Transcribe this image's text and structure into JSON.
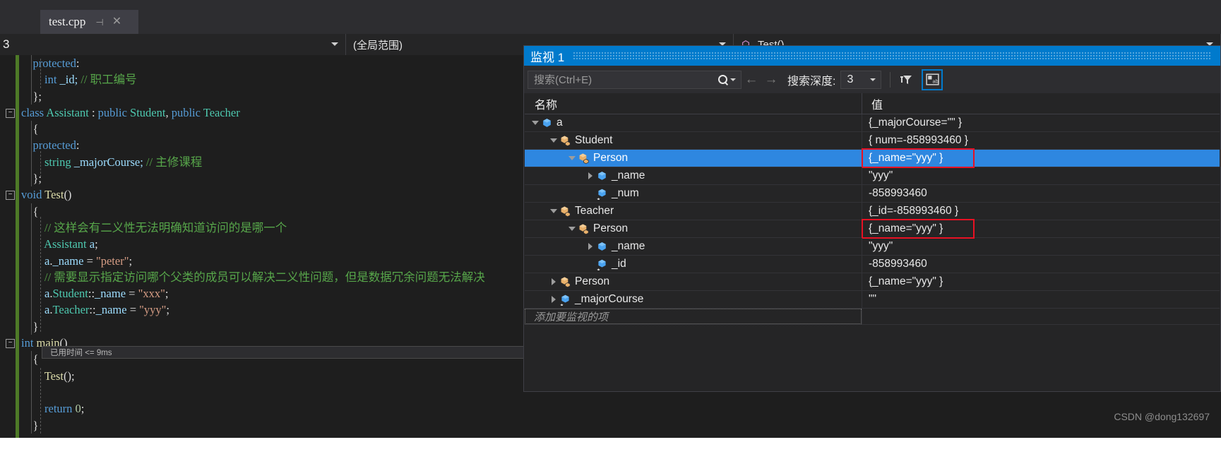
{
  "editor": {
    "tab": {
      "title": "test.cpp",
      "pin_icon": "pin-icon",
      "close_icon": "close-icon"
    },
    "navbar": {
      "left_value": "3",
      "scope_value": "(全局范围)",
      "member_value": "Test()"
    },
    "elapsed_tooltip": "已用时间 <= 9ms",
    "lines": [
      {
        "indent": 1,
        "tokens": [
          {
            "t": "protected",
            "c": "kw"
          },
          {
            "t": ":",
            "c": "plain"
          }
        ]
      },
      {
        "indent": 2,
        "tokens": [
          {
            "t": "int",
            "c": "kw"
          },
          {
            "t": " _id; ",
            "c": "var"
          },
          {
            "t": "// 职工编号",
            "c": "cmt"
          }
        ]
      },
      {
        "indent": 1,
        "tokens": [
          {
            "t": "};",
            "c": "plain"
          }
        ]
      },
      {
        "indent": 0,
        "tokens": [
          {
            "t": "class",
            "c": "kw"
          },
          {
            "t": " ",
            "c": "plain"
          },
          {
            "t": "Assistant",
            "c": "type"
          },
          {
            "t": " : ",
            "c": "plain"
          },
          {
            "t": "public",
            "c": "kw"
          },
          {
            "t": " ",
            "c": "plain"
          },
          {
            "t": "Student",
            "c": "type"
          },
          {
            "t": ", ",
            "c": "plain"
          },
          {
            "t": "public",
            "c": "kw"
          },
          {
            "t": " ",
            "c": "plain"
          },
          {
            "t": "Teacher",
            "c": "type"
          }
        ]
      },
      {
        "indent": 1,
        "tokens": [
          {
            "t": "{",
            "c": "plain"
          }
        ]
      },
      {
        "indent": 1,
        "tokens": [
          {
            "t": "protected",
            "c": "kw"
          },
          {
            "t": ":",
            "c": "plain"
          }
        ]
      },
      {
        "indent": 2,
        "tokens": [
          {
            "t": "string",
            "c": "type"
          },
          {
            "t": " _majorCourse; ",
            "c": "var"
          },
          {
            "t": "// 主修课程",
            "c": "cmt"
          }
        ]
      },
      {
        "indent": 1,
        "tokens": [
          {
            "t": "};",
            "c": "plain"
          }
        ]
      },
      {
        "indent": 0,
        "tokens": [
          {
            "t": "void",
            "c": "kw"
          },
          {
            "t": " ",
            "c": "plain"
          },
          {
            "t": "Test",
            "c": "fn"
          },
          {
            "t": "()",
            "c": "plain"
          }
        ]
      },
      {
        "indent": 1,
        "tokens": [
          {
            "t": "{",
            "c": "plain"
          }
        ]
      },
      {
        "indent": 2,
        "tokens": [
          {
            "t": "// 这样会有二义性无法明确知道访问的是哪一个",
            "c": "cmt"
          }
        ]
      },
      {
        "indent": 2,
        "tokens": [
          {
            "t": "Assistant",
            "c": "type"
          },
          {
            "t": " ",
            "c": "plain"
          },
          {
            "t": "a",
            "c": "var"
          },
          {
            "t": ";",
            "c": "plain"
          }
        ]
      },
      {
        "indent": 2,
        "tokens": [
          {
            "t": "a",
            "c": "var"
          },
          {
            "t": ".",
            "c": "plain"
          },
          {
            "t": "_name",
            "c": "var"
          },
          {
            "t": " = ",
            "c": "plain"
          },
          {
            "t": "\"peter\"",
            "c": "str"
          },
          {
            "t": ";",
            "c": "plain"
          }
        ]
      },
      {
        "indent": 2,
        "tokens": [
          {
            "t": "// 需要显示指定访问哪个父类的成员可以解决二义性问题，但是数据冗余问题无法解决",
            "c": "cmt"
          }
        ]
      },
      {
        "indent": 2,
        "tokens": [
          {
            "t": "a",
            "c": "var"
          },
          {
            "t": ".",
            "c": "plain"
          },
          {
            "t": "Student",
            "c": "type"
          },
          {
            "t": "::",
            "c": "plain"
          },
          {
            "t": "_name",
            "c": "var"
          },
          {
            "t": " = ",
            "c": "plain"
          },
          {
            "t": "\"xxx\"",
            "c": "str"
          },
          {
            "t": ";",
            "c": "plain"
          }
        ]
      },
      {
        "indent": 2,
        "tokens": [
          {
            "t": "a",
            "c": "var"
          },
          {
            "t": ".",
            "c": "plain"
          },
          {
            "t": "Teacher",
            "c": "type"
          },
          {
            "t": "::",
            "c": "plain"
          },
          {
            "t": "_name",
            "c": "var"
          },
          {
            "t": " = ",
            "c": "plain"
          },
          {
            "t": "\"yyy\"",
            "c": "str"
          },
          {
            "t": ";",
            "c": "plain"
          }
        ]
      },
      {
        "indent": 1,
        "tokens": [
          {
            "t": "}",
            "c": "plain"
          }
        ]
      },
      {
        "indent": 0,
        "tokens": [
          {
            "t": "int",
            "c": "kw"
          },
          {
            "t": " ",
            "c": "plain"
          },
          {
            "t": "main",
            "c": "fn"
          },
          {
            "t": "()",
            "c": "plain"
          }
        ]
      },
      {
        "indent": 1,
        "tokens": [
          {
            "t": "{",
            "c": "plain"
          }
        ]
      },
      {
        "indent": 2,
        "tokens": [
          {
            "t": "Test",
            "c": "fn"
          },
          {
            "t": "();",
            "c": "plain"
          }
        ]
      },
      {
        "indent": 2,
        "tokens": []
      },
      {
        "indent": 2,
        "tokens": [
          {
            "t": "return",
            "c": "kw"
          },
          {
            "t": " ",
            "c": "plain"
          },
          {
            "t": "0",
            "c": "num"
          },
          {
            "t": ";",
            "c": "plain"
          }
        ]
      },
      {
        "indent": 1,
        "tokens": [
          {
            "t": "}",
            "c": "plain"
          }
        ]
      }
    ]
  },
  "watch": {
    "title": "监视 1",
    "search": {
      "placeholder": "搜索(Ctrl+E)",
      "search_icon": "search-icon",
      "dropdown_icon": "chevron-down-icon"
    },
    "nav_prev_icon": "arrow-left-icon",
    "nav_next_icon": "arrow-right-icon",
    "depth_label": "搜索深度:",
    "depth_value": "3",
    "filter_icon": "filter-icon",
    "hex_icon": "hex-display-icon",
    "columns": {
      "name": "名称",
      "value": "值"
    },
    "add_row_text": "添加要监视的项",
    "accent": "#007acc",
    "selection_color": "#2e87e0",
    "highlight_color": "#e81123",
    "rows": [
      {
        "depth": 0,
        "expander": "open",
        "icon": "field-icon",
        "name": "a",
        "value": "{_majorCourse=\"\" }",
        "selected": false,
        "highlight": false
      },
      {
        "depth": 1,
        "expander": "open",
        "icon": "class-icon",
        "name": "Student",
        "value": "{ num=-858993460 }",
        "selected": false,
        "highlight": false
      },
      {
        "depth": 2,
        "expander": "open",
        "icon": "class-icon",
        "name": "Person",
        "value": "{_name=\"yyy\" }",
        "selected": true,
        "highlight": true
      },
      {
        "depth": 3,
        "expander": "closed",
        "icon": "field-icon",
        "name": "_name",
        "value": "\"yyy\"",
        "selected": false,
        "highlight": false
      },
      {
        "depth": 3,
        "expander": "none",
        "icon": "member-icon",
        "name": "_num",
        "value": "-858993460",
        "selected": false,
        "highlight": false
      },
      {
        "depth": 1,
        "expander": "open",
        "icon": "class-icon",
        "name": "Teacher",
        "value": "{_id=-858993460 }",
        "selected": false,
        "highlight": false
      },
      {
        "depth": 2,
        "expander": "open",
        "icon": "class-icon",
        "name": "Person",
        "value": "{_name=\"yyy\" }",
        "selected": false,
        "highlight": true
      },
      {
        "depth": 3,
        "expander": "closed",
        "icon": "field-icon",
        "name": "_name",
        "value": "\"yyy\"",
        "selected": false,
        "highlight": false
      },
      {
        "depth": 3,
        "expander": "none",
        "icon": "member-icon",
        "name": "_id",
        "value": "-858993460",
        "selected": false,
        "highlight": false
      },
      {
        "depth": 1,
        "expander": "closed",
        "icon": "class-icon",
        "name": "Person",
        "value": "{_name=\"yyy\" }",
        "selected": false,
        "highlight": false
      },
      {
        "depth": 1,
        "expander": "closed",
        "icon": "member-icon",
        "name": "_majorCourse",
        "value": "\"\"",
        "selected": false,
        "highlight": false
      }
    ]
  },
  "credit": "CSDN @dong132697"
}
